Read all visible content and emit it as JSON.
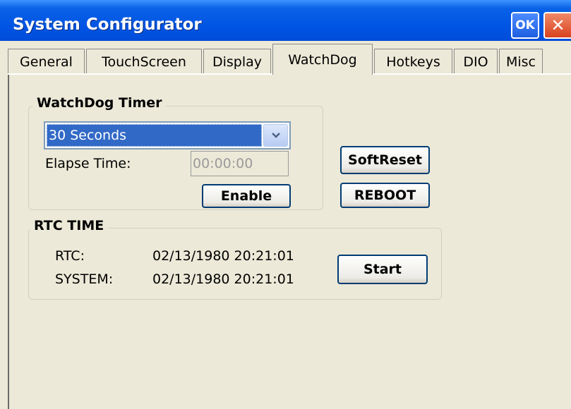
{
  "window": {
    "title": "System Configurator",
    "ok_label": "OK",
    "close_glyph": "✕"
  },
  "tabs": [
    {
      "label": "General",
      "active": false
    },
    {
      "label": "TouchScreen",
      "active": false
    },
    {
      "label": "Display",
      "active": false
    },
    {
      "label": "WatchDog",
      "active": true
    },
    {
      "label": "Hotkeys",
      "active": false
    },
    {
      "label": "DIO",
      "active": false
    },
    {
      "label": "Misc",
      "active": false
    }
  ],
  "watchdog": {
    "group_label": "WatchDog Timer",
    "timer_selected": "30 Seconds",
    "elapse_label": "Elapse Time:",
    "elapse_value": "00:00:00",
    "enable_label": "Enable"
  },
  "actions": {
    "softreset_label": "SoftReset",
    "reboot_label": "REBOOT"
  },
  "rtc": {
    "group_label": "RTC TIME",
    "rtc_label": "RTC:",
    "rtc_value": "02/13/1980 20:21:01",
    "system_label": "SYSTEM:",
    "system_value": "02/13/1980 20:21:01",
    "start_label": "Start"
  },
  "icons": {
    "dropdown": "chevron-down-icon",
    "close": "close-icon"
  }
}
